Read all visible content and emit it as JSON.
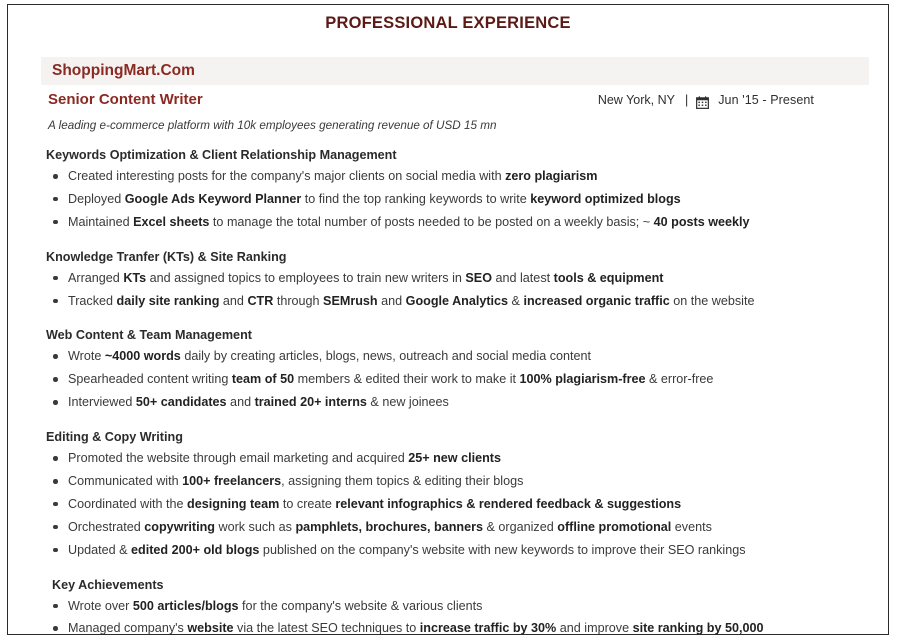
{
  "document": {
    "section_title": "PROFESSIONAL EXPERIENCE",
    "company": "ShoppingMart.Com",
    "role": "Senior Content Writer",
    "location": "New York, NY",
    "separator": "|",
    "calendar_icon": "calendar-icon",
    "dates": "Jun '15 -  Present",
    "tagline": "A leading e-commerce platform with 10k employees generating revenue of USD 15 mn",
    "accent_color": "#8a2a22",
    "title_color": "#5c1a16",
    "band_color": "#f4f3f2"
  },
  "groups": [
    {
      "heading": "Keywords Optimization & Client Relationship Management",
      "indented": false,
      "bullets": [
        [
          {
            "t": "Created interesting posts for the company's major clients on social media with ",
            "b": false
          },
          {
            "t": "zero plagiarism",
            "b": true
          }
        ],
        [
          {
            "t": "Deployed ",
            "b": false
          },
          {
            "t": "Google Ads Keyword Planner",
            "b": true
          },
          {
            "t": " to find the top ranking keywords to write ",
            "b": false
          },
          {
            "t": "keyword optimized blogs",
            "b": true
          }
        ],
        [
          {
            "t": "Maintained ",
            "b": false
          },
          {
            "t": "Excel sheets",
            "b": true
          },
          {
            "t": " to manage the total number of posts needed to be posted on a weekly basis; ~ ",
            "b": false
          },
          {
            "t": "40 posts weekly",
            "b": true
          }
        ]
      ]
    },
    {
      "heading": "Knowledge Tranfer (KTs) & Site Ranking",
      "indented": false,
      "bullets": [
        [
          {
            "t": "Arranged ",
            "b": false
          },
          {
            "t": "KTs",
            "b": true
          },
          {
            "t": " and assigned topics to employees to train new writers in ",
            "b": false
          },
          {
            "t": "SEO",
            "b": true
          },
          {
            "t": " and latest ",
            "b": false
          },
          {
            "t": "tools & equipment",
            "b": true
          }
        ],
        [
          {
            "t": "Tracked ",
            "b": false
          },
          {
            "t": "daily site ranking",
            "b": true
          },
          {
            "t": " and ",
            "b": false
          },
          {
            "t": "CTR",
            "b": true
          },
          {
            "t": " through ",
            "b": false
          },
          {
            "t": "SEMrush",
            "b": true
          },
          {
            "t": " and ",
            "b": false
          },
          {
            "t": "Google Analytics",
            "b": true
          },
          {
            "t": " & ",
            "b": false
          },
          {
            "t": "increased organic traffic",
            "b": true
          },
          {
            "t": " on the website",
            "b": false
          }
        ]
      ]
    },
    {
      "heading": "Web Content & Team Management",
      "indented": false,
      "bullets": [
        [
          {
            "t": "Wrote ",
            "b": false
          },
          {
            "t": "~4000 words",
            "b": true
          },
          {
            "t": " daily by creating articles, blogs, news, outreach and social media content",
            "b": false
          }
        ],
        [
          {
            "t": "Spearheaded content writing ",
            "b": false
          },
          {
            "t": "team of 50",
            "b": true
          },
          {
            "t": " members & edited their work to make it ",
            "b": false
          },
          {
            "t": "100% plagiarism-free",
            "b": true
          },
          {
            "t": " & error-free",
            "b": false
          }
        ],
        [
          {
            "t": "Interviewed ",
            "b": false
          },
          {
            "t": "50+ candidates",
            "b": true
          },
          {
            "t": " and ",
            "b": false
          },
          {
            "t": "trained 20+ interns",
            "b": true
          },
          {
            "t": " & new joinees",
            "b": false
          }
        ]
      ]
    },
    {
      "heading": "Editing & Copy Writing",
      "indented": false,
      "bullets": [
        [
          {
            "t": "Promoted the website through email marketing and acquired ",
            "b": false
          },
          {
            "t": "25+ new clients",
            "b": true
          }
        ],
        [
          {
            "t": "Communicated with ",
            "b": false
          },
          {
            "t": "100+ freelancers",
            "b": true
          },
          {
            "t": ", assigning them topics & editing their blogs",
            "b": false
          }
        ],
        [
          {
            "t": "Coordinated with the ",
            "b": false
          },
          {
            "t": "designing team",
            "b": true
          },
          {
            "t": " to create ",
            "b": false
          },
          {
            "t": "relevant infographics & rendered feedback & suggestions",
            "b": true
          }
        ],
        [
          {
            "t": "Orchestrated ",
            "b": false
          },
          {
            "t": "copywriting",
            "b": true
          },
          {
            "t": " work such as ",
            "b": false
          },
          {
            "t": "pamphlets, brochures, banners",
            "b": true
          },
          {
            "t": " & organized ",
            "b": false
          },
          {
            "t": "offline promotional",
            "b": true
          },
          {
            "t": " events",
            "b": false
          }
        ],
        [
          {
            "t": "Updated & ",
            "b": false
          },
          {
            "t": "edited 200+ old blogs",
            "b": true
          },
          {
            "t": " published on the company's website with new keywords to improve their SEO rankings",
            "b": false
          }
        ]
      ]
    },
    {
      "heading": "Key Achievements",
      "indented": true,
      "bullets": [
        [
          {
            "t": "Wrote over ",
            "b": false
          },
          {
            "t": "500 articles/blogs",
            "b": true
          },
          {
            "t": " for the company's website & various clients",
            "b": false
          }
        ],
        [
          {
            "t": "Managed company's ",
            "b": false
          },
          {
            "t": "website",
            "b": true
          },
          {
            "t": " via the latest SEO techniques to ",
            "b": false
          },
          {
            "t": "increase traffic by 30%",
            "b": true
          },
          {
            "t": " and improve ",
            "b": false
          },
          {
            "t": "site ranking by 50,000",
            "b": true
          }
        ]
      ]
    }
  ]
}
